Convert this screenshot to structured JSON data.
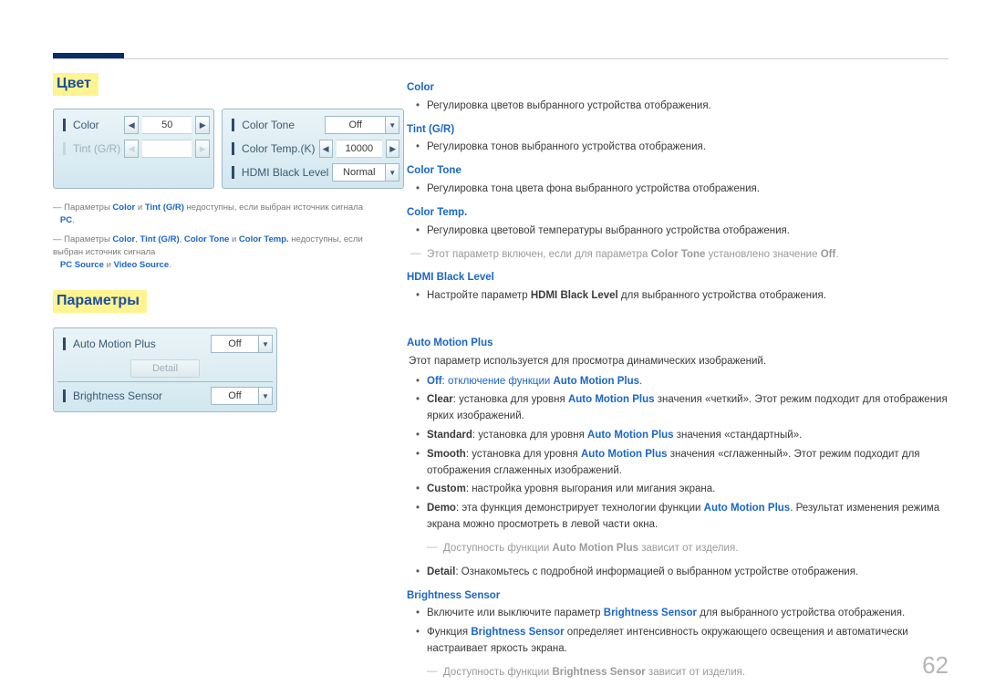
{
  "page_number": "62",
  "left": {
    "heading_color": "Цвет",
    "panel_color": {
      "color_label": "Color",
      "color_value": "50",
      "tint_label": "Tint (G/R)",
      "tone_label": "Color Tone",
      "tone_value": "Off",
      "temp_label": "Color Temp.(K)",
      "temp_value": "10000",
      "hdmi_label": "HDMI Black Level",
      "hdmi_value": "Normal"
    },
    "foot1_pre": "Параметры ",
    "foot1_b1": "Color",
    "foot1_mid1": " и ",
    "foot1_b2": "Tint (G/R)",
    "foot1_post": " недоступны, если выбран источник сигнала ",
    "foot1_pc": "PC",
    "foot2_pre": "Параметры ",
    "foot2_b1": "Color",
    "foot2_c1": ", ",
    "foot2_b2": "Tint (G/R)",
    "foot2_c2": ", ",
    "foot2_b3": "Color Tone",
    "foot2_c3": " и ",
    "foot2_b4": "Color Temp.",
    "foot2_post": " недоступны, если выбран источник сигнала ",
    "foot2_src1": "PC Source",
    "foot2_c4": " и ",
    "foot2_src2": "Video Source",
    "heading_params": "Параметры",
    "panel_params": {
      "amp_label": "Auto Motion Plus",
      "amp_value": "Off",
      "detail_label": "Detail",
      "bs_label": "Brightness Sensor",
      "bs_value": "Off"
    }
  },
  "right": {
    "color": {
      "h": "Color",
      "t": "Регулировка цветов выбранного устройства отображения."
    },
    "tint": {
      "h": "Tint (G/R)",
      "t": "Регулировка тонов выбранного устройства отображения."
    },
    "ctone": {
      "h": "Color Tone",
      "t": "Регулировка тона цвета фона выбранного устройства отображения."
    },
    "ctemp": {
      "h": "Color Temp.",
      "t": "Регулировка цветовой температуры выбранного устройства отображения.",
      "note_pre": "Этот параметр включен, если для параметра ",
      "note_b1": "Color Tone",
      "note_mid": " установлено значение ",
      "note_b2": "Off",
      "note_post": "."
    },
    "hdmi": {
      "h": "HDMI Black Level",
      "t_pre": "Настройте параметр ",
      "t_b": "HDMI Black Level",
      "t_post": " для выбранного устройства отображения."
    },
    "amp": {
      "h": "Auto Motion Plus",
      "intro": "Этот параметр используется для просмотра динамических изображений.",
      "off_b": "Off",
      "off_mid": ": отключение функции ",
      "off_link": "Auto Motion Plus",
      "off_post": ".",
      "clear_b": "Clear",
      "clear_t1": ": установка для уровня ",
      "clear_link": "Auto Motion Plus",
      "clear_t2": " значения «четкий». Этот режим подходит для отображения ярких изображений.",
      "std_b": "Standard",
      "std_t1": ": установка для уровня ",
      "std_link": "Auto Motion Plus",
      "std_t2": " значения «стандартный».",
      "smooth_b": "Smooth",
      "smooth_t1": ": установка для уровня ",
      "smooth_link": "Auto Motion Plus",
      "smooth_t2": " значения «сглаженный». Этот режим подходит для отображения сглаженных изображений.",
      "custom_b": "Custom",
      "custom_t": ": настройка уровня выгорания или мигания экрана.",
      "demo_b": "Demo",
      "demo_t1": ": эта функция демонстрирует технологии функции ",
      "demo_link": "Auto Motion Plus",
      "demo_t2": ". Результат изменения режима экрана можно просмотреть в левой части окна.",
      "avail_pre": "Доступность функции ",
      "avail_b": "Auto Motion Plus",
      "avail_post": " зависит от изделия.",
      "detail_b": "Detail",
      "detail_t": ": Ознакомьтесь с подробной информацией о выбранном устройстве отображения."
    },
    "bs": {
      "h": "Brightness Sensor",
      "t1_pre": "Включите или выключите параметр ",
      "t1_b": "Brightness Sensor",
      "t1_post": " для выбранного устройства отображения.",
      "t2_pre": "Функция ",
      "t2_b": "Brightness Sensor",
      "t2_post": " определяет интенсивность окружающего освещения и автоматически настраивает яркость экрана.",
      "avail_pre": "Доступность функции ",
      "avail_b": "Brightness Sensor",
      "avail_post": " зависит от изделия."
    }
  }
}
